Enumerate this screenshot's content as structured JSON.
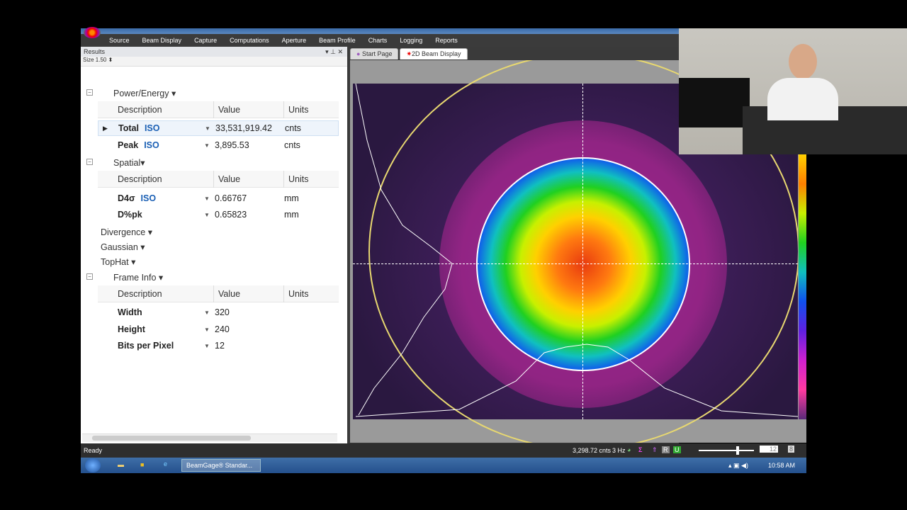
{
  "menu": [
    "Source",
    "Beam Display",
    "Capture",
    "Computations",
    "Aperture",
    "Beam Profile",
    "Charts",
    "Logging",
    "Reports"
  ],
  "results_panel": {
    "title": "Results",
    "size_label": "Size 1.50",
    "groups": [
      {
        "name": "Power/Energy",
        "headers": [
          "Description",
          "Value",
          "Units"
        ],
        "rows": [
          {
            "desc": "Total",
            "iso": "ISO",
            "value": "33,531,919.42",
            "units": "cnts"
          },
          {
            "desc": "Peak",
            "iso": "ISO",
            "value": "3,895.53",
            "units": "cnts"
          }
        ]
      },
      {
        "name": "Spatial",
        "headers": [
          "Description",
          "Value",
          "Units"
        ],
        "rows": [
          {
            "desc": "D4σ",
            "iso": "ISO",
            "value": "0.66767",
            "units": "mm"
          },
          {
            "desc": "D%pk",
            "value": "0.65823",
            "units": "mm"
          }
        ]
      },
      {
        "name": "Divergence"
      },
      {
        "name": "Gaussian"
      },
      {
        "name": "TopHat"
      },
      {
        "name": "Frame Info",
        "headers": [
          "Description",
          "Value",
          "Units"
        ],
        "rows": [
          {
            "desc": "Width",
            "value": "320"
          },
          {
            "desc": "Height",
            "value": "240"
          },
          {
            "desc": "Bits per Pixel",
            "value": "12"
          }
        ]
      }
    ]
  },
  "tabs": [
    "Start Page",
    "2D Beam Display"
  ],
  "status": {
    "ready": "Ready",
    "counts": "3,298.72 cnts",
    "rate": "3 Hz",
    "r": "R",
    "u": "U",
    "zoom_value": "12",
    "bits": "8",
    "slider": 0.7
  },
  "taskbar": {
    "app": "BeamGage® Standar...",
    "time": "10:58 AM"
  }
}
